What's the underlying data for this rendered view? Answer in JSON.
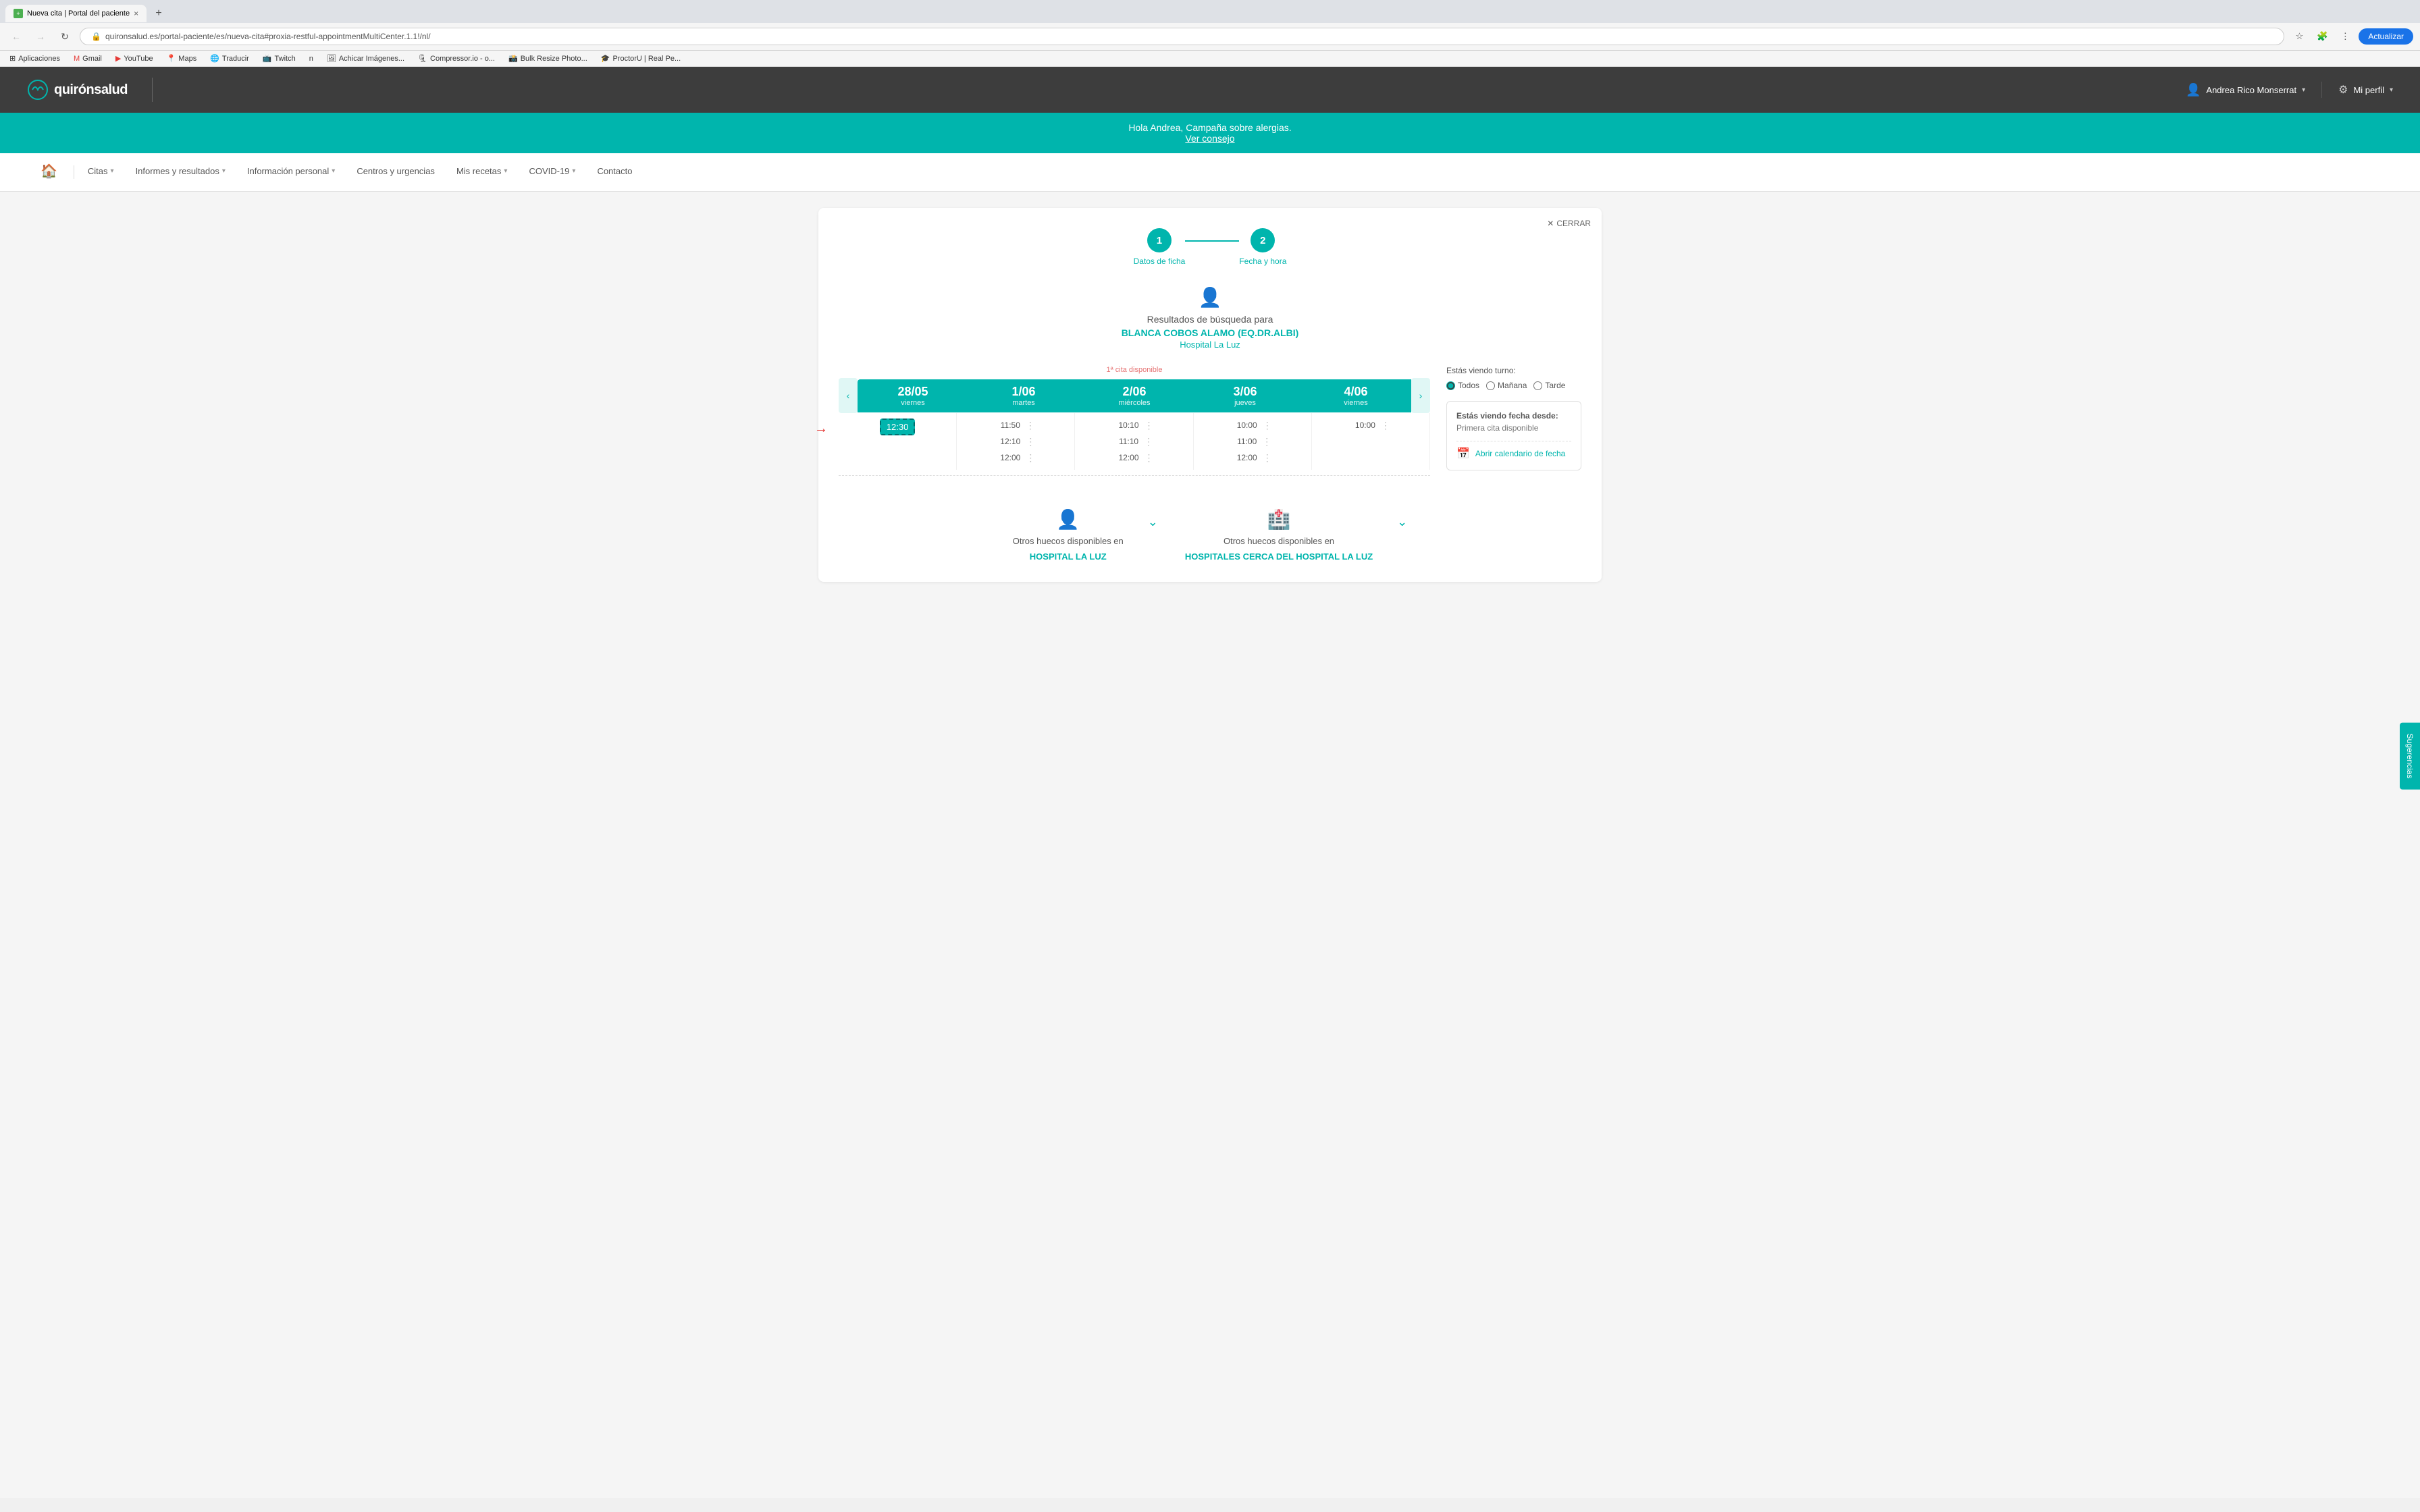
{
  "browser": {
    "tab": {
      "favicon_color": "#4caf50",
      "title": "Nueva cita | Portal del paciente",
      "close": "×"
    },
    "new_tab": "+",
    "nav": {
      "back_disabled": true,
      "forward_disabled": true,
      "refresh": "↻",
      "address": "quironsalud.es/portal-paciente/es/nueva-cita#proxia-restful-appointmentMultiCenter.1.1!/nl/",
      "update_btn": "Actualizar"
    },
    "bookmarks": [
      {
        "label": "Aplicaciones",
        "icon": "⊞"
      },
      {
        "label": "Gmail",
        "icon": "✉"
      },
      {
        "label": "YouTube",
        "icon": "▶"
      },
      {
        "label": "Maps",
        "icon": "📍"
      },
      {
        "label": "Traducir",
        "icon": "🌐"
      },
      {
        "label": "Twitch",
        "icon": "📺"
      },
      {
        "label": "n",
        "icon": "n"
      },
      {
        "label": "Achicar Imágenes...",
        "icon": "🖼"
      },
      {
        "label": "Compressor.io - o...",
        "icon": "🗜"
      },
      {
        "label": "Bulk Resize Photo...",
        "icon": "📸"
      },
      {
        "label": "ProctorU | Real Pe...",
        "icon": "🎓"
      }
    ]
  },
  "site": {
    "logo_text": "quirónsalud",
    "header": {
      "user_name": "Andrea Rico Monserrat",
      "profile_label": "Mi perfil"
    },
    "banner": {
      "greeting": "Hola Andrea,",
      "message": "Campaña sobre alergias.",
      "link_text": "Ver consejo"
    },
    "nav": {
      "home_icon": "🏠",
      "items": [
        {
          "label": "Citas",
          "has_chevron": true
        },
        {
          "label": "Informes y resultados",
          "has_chevron": true
        },
        {
          "label": "Información personal",
          "has_chevron": true
        },
        {
          "label": "Centros y urgencias",
          "has_chevron": false
        },
        {
          "label": "Mis recetas",
          "has_chevron": true
        },
        {
          "label": "COVID-19",
          "has_chevron": true
        },
        {
          "label": "Contacto",
          "has_chevron": false
        }
      ]
    }
  },
  "appointment": {
    "close_label": "CERRAR",
    "steps": [
      {
        "number": "1",
        "label": "Datos de ficha",
        "active": true
      },
      {
        "number": "2",
        "label": "Fecha y hora",
        "active": true
      }
    ],
    "search_label": "Resultados de búsqueda para",
    "doctor_name": "BLANCA COBOS ALAMO (EQ.DR.ALBI)",
    "hospital": "Hospital La Luz",
    "first_available_label": "1ª cita disponible",
    "days": [
      {
        "date": "28/05",
        "day": "viernes"
      },
      {
        "date": "1/06",
        "day": "martes"
      },
      {
        "date": "2/06",
        "day": "miércoles"
      },
      {
        "date": "3/06",
        "day": "jueves"
      },
      {
        "date": "4/06",
        "day": "viernes"
      }
    ],
    "slots": [
      {
        "times": [
          {
            "time": "12:30",
            "selected": true
          }
        ]
      },
      {
        "times": [
          {
            "time": "11:50"
          },
          {
            "time": "12:10"
          },
          {
            "time": "12:00"
          }
        ]
      },
      {
        "times": [
          {
            "time": "10:10"
          },
          {
            "time": "11:10"
          },
          {
            "time": "12:00"
          }
        ]
      },
      {
        "times": [
          {
            "time": "10:00"
          },
          {
            "time": "11:00"
          },
          {
            "time": "12:00"
          }
        ]
      },
      {
        "times": [
          {
            "time": "10:00"
          }
        ]
      }
    ],
    "turno": {
      "label": "Estás viendo turno:",
      "options": [
        "Todos",
        "Mañana",
        "Tarde"
      ],
      "selected": "Todos"
    },
    "date_info": {
      "title": "Estás viendo fecha desde:",
      "value": "Primera cita disponible",
      "calendar_label": "Abrir calendario de fecha"
    },
    "bottom": {
      "left": {
        "icon": "👤",
        "text": "Otros huecos disponibles en",
        "link": "HOSPITAL LA LUZ"
      },
      "right": {
        "icon": "🏥",
        "text": "Otros huecos disponibles en",
        "link": "HOSPITALES CERCA DEL HOSPITAL LA LUZ"
      }
    }
  },
  "suggestions_tab": "Sugerencias"
}
